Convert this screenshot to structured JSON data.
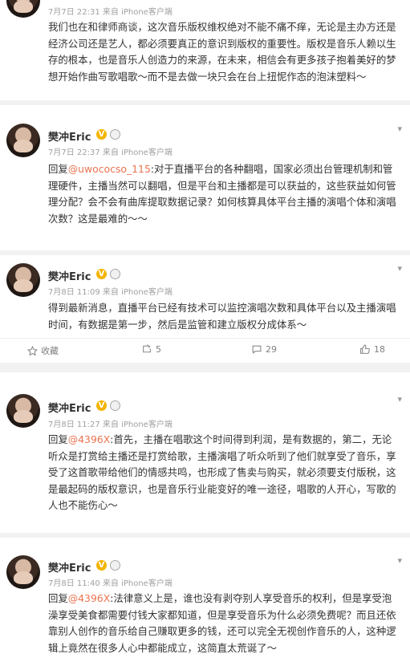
{
  "posts": [
    {
      "meta": "7月7日 22:31 来自 iPhone客户端",
      "text": "我们也在和律师商谈，这次音乐版权维权绝对不能不痛不痒，无论是主办方还是经济公司还是艺人，都必须要真正的意识到版权的重要性。版权是音乐人赖以生存的根本，也是音乐人创造力的来源，在未来，相信会有更多孩子抱着美好的梦想开始作曲写歌唱歌～而不是去做一块只会在台上扭怩作态的泡沫塑料～"
    },
    {
      "name": "樊冲Eric",
      "meta": "7月7日 22:37 来自 iPhone客户端",
      "reply": "回复",
      "mention": "@uwococso_115",
      "text": ":对于直播平台的各种翻唱，国家必须出台管理机制和管理硬件，主播当然可以翻唱，但是平台和主播都是可以获益的，这些获益如何管理分配？会不会有曲库提取数据记录？如何核算具体平台主播的演唱个体和演唱次数？这是最难的～～"
    },
    {
      "name": "樊冲Eric",
      "meta": "7月8日 11:09 来自 iPhone客户端",
      "text": "得到最新消息，直播平台已经有技术可以监控演唱次数和具体平台以及主播演唱时间，有数据是第一步，然后是监管和建立版权分成体系～"
    },
    {
      "name": "樊冲Eric",
      "meta": "7月8日 11:27 来自 iPhone客户端",
      "reply": "回复",
      "mention": "@4396X",
      "text": ":首先，主播在唱歌这个时间得到利润，是有数据的，第二，无论听众是打赏给主播还是打赏给歌，主播演唱了听众听到了他们就享受了音乐，享受了这首歌带给他们的情感共鸣，也形成了售卖与购买，就必须要支付版税，这是最起码的版权意识，也是音乐行业能变好的唯一途径，唱歌的人开心，写歌的人也不能伤心～"
    },
    {
      "name": "樊冲Eric",
      "meta": "7月8日 11:40 来自 iPhone客户端",
      "reply": "回复",
      "mention": "@4396X",
      "text": ":法律意义上是，谁也没有剥夺别人享受音乐的权利，但是享受泡澡享受美食都需要付钱大家都知道，但是享受音乐为什么必须免费呢？而且还依靠别人创作的音乐给自己赚取更多的钱，还可以完全无视创作音乐的人，这种逻辑上竟然在很多人心中都能成立，这简直太荒诞了～"
    }
  ],
  "actions": {
    "favorite": "收藏",
    "repost": "5",
    "comment": "29",
    "like": "18"
  },
  "colors": {
    "mention": "#eb7350",
    "vip_badge": "#f4b400"
  },
  "icons": [
    "star-icon",
    "repost-icon",
    "comment-icon",
    "like-icon",
    "chevron-down-icon",
    "verified-v-icon",
    "member-badge-icon"
  ]
}
